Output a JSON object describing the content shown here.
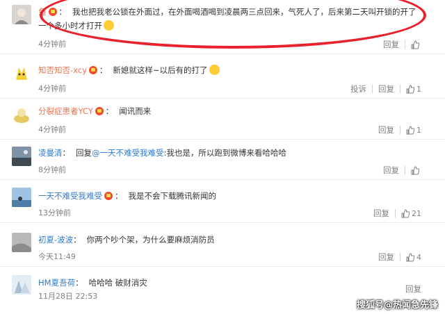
{
  "comments": [
    {
      "user": "鱼",
      "text": "我也把我老公锁在外面过，在外面喝酒喝到凌晨两三点回来，气死人了，后来第二天叫开锁的开了",
      "text2": "一个多小时才打开",
      "time": "4分钟前",
      "reply": "回复",
      "likes": ""
    },
    {
      "user": "知否知否-xcy",
      "text": "新媳就这样~以后有的打了",
      "time": "4分钟前",
      "report": "投诉",
      "reply": "回复",
      "likes": "1"
    },
    {
      "user": "分裂症患者YCY",
      "text": "闻讯而来",
      "time": "4分钟前",
      "reply": "回复",
      "likes": "1"
    },
    {
      "user": "凌曼清",
      "reply_prefix": "回复",
      "mention": "@一天不难受我难受",
      "text": "我也是，所以跑到微博来看哈哈哈",
      "time": "8分钟前",
      "reply": "回复",
      "likes": ""
    },
    {
      "user": "一天不难受我难受",
      "text": "我是不会下载腾讯新闻的",
      "time": "13分钟前",
      "reply": "回复",
      "likes": "21"
    },
    {
      "user": "初夏-波波",
      "text": "你两个吵个架，为什么要麻烦消防员",
      "time": "今天11:49",
      "reply": "回复",
      "likes": "4"
    },
    {
      "user": "HM夏吾荷",
      "text": "哈哈哈 破财消灾",
      "time": "11月28日 22:53",
      "reply": "回复",
      "likes": ""
    }
  ],
  "watermark": "搜狐号@热闻急先锋",
  "colors": {
    "username": "#eb7350",
    "link": "#2e7bcf",
    "highlight": "#e8212d"
  }
}
